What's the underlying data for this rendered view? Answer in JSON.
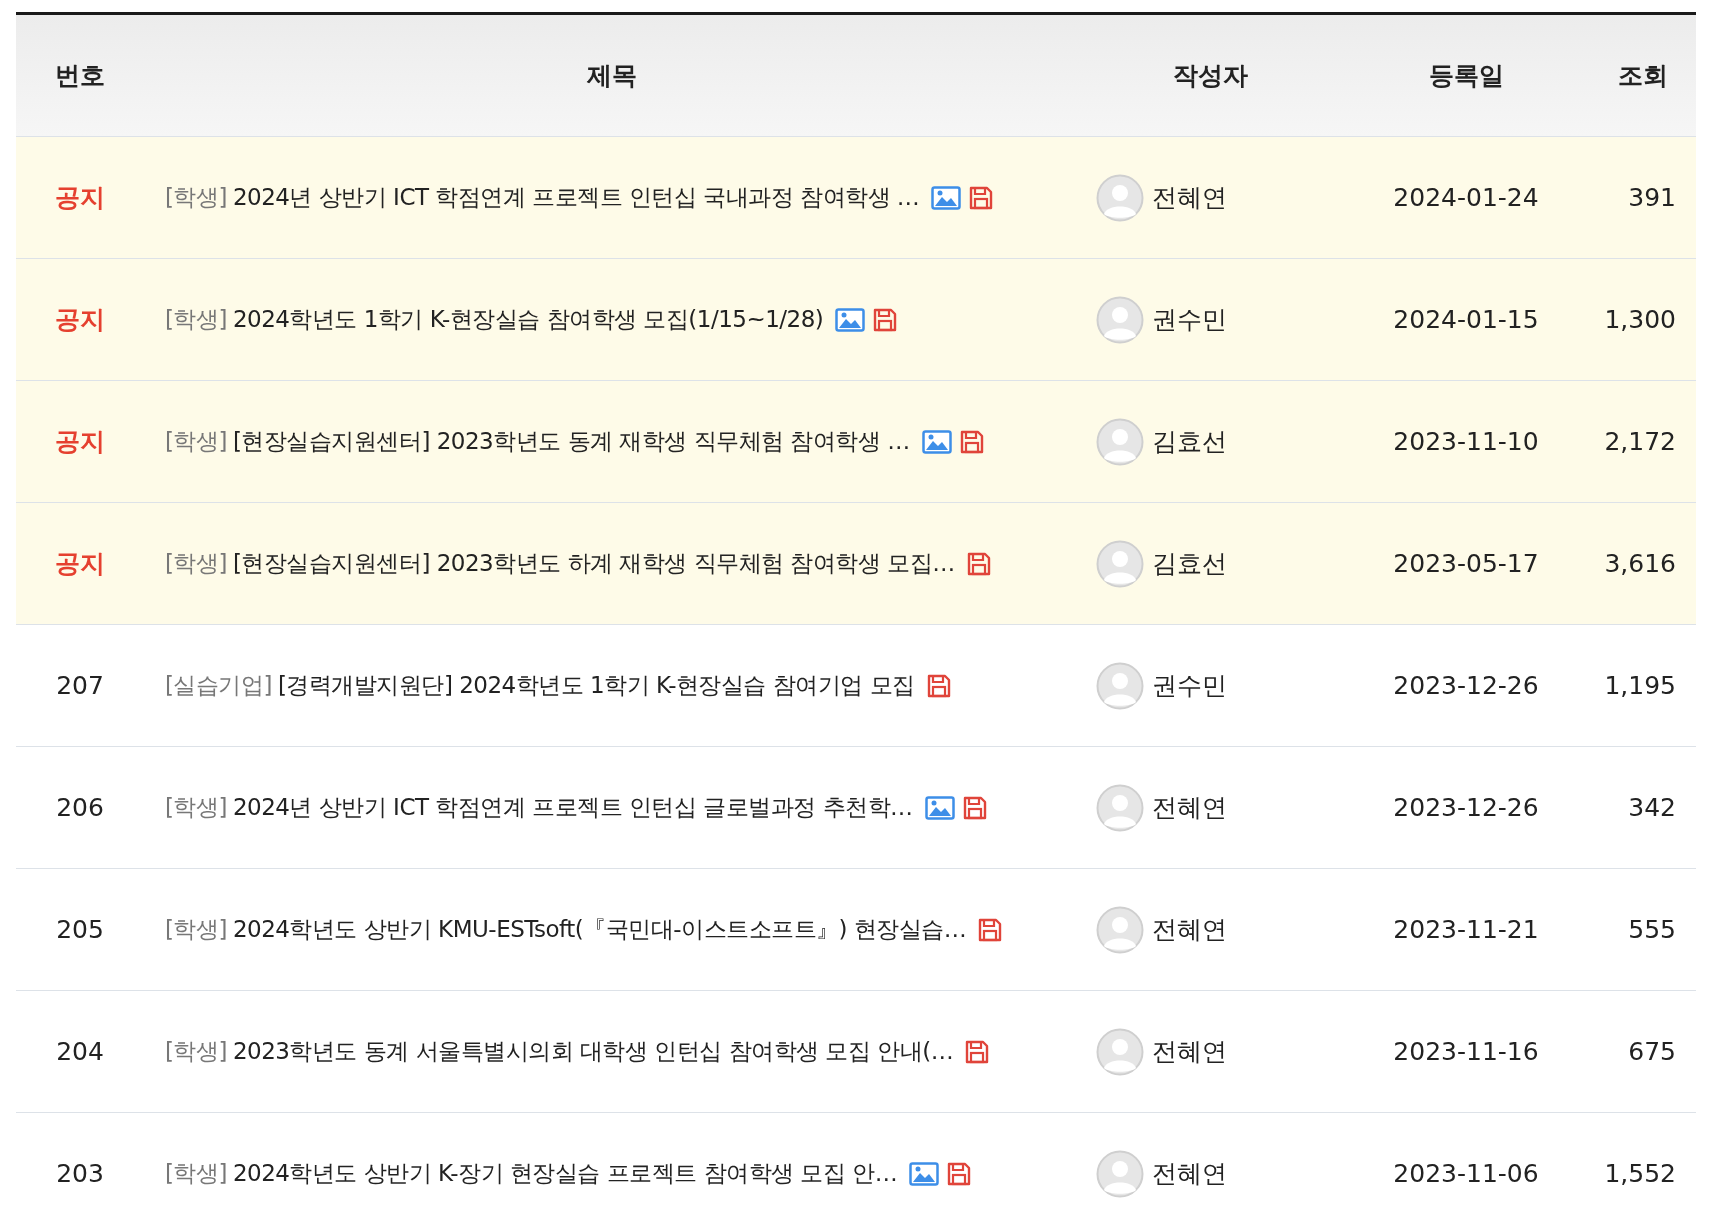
{
  "table": {
    "columns": [
      {
        "label": "번호",
        "kind": "number"
      },
      {
        "label": "제목",
        "kind": "title"
      },
      {
        "label": "작성자",
        "kind": "author"
      },
      {
        "label": "등록일",
        "kind": "date"
      },
      {
        "label": "조회",
        "kind": "views"
      }
    ],
    "rows": [
      {
        "number": "공지",
        "pinned": true,
        "category": "[학생]",
        "title": "2024년 상반기 ICT 학점연계 프로젝트 인턴십 국내과정 참여학생 …",
        "has_image": true,
        "has_file": true,
        "author": "전혜연",
        "date": "2024-01-24",
        "views": "391"
      },
      {
        "number": "공지",
        "pinned": true,
        "category": "[학생]",
        "title": "2024학년도 1학기 K-현장실습 참여학생 모집(1/15~1/28)",
        "has_image": true,
        "has_file": true,
        "author": "권수민",
        "date": "2024-01-15",
        "views": "1,300"
      },
      {
        "number": "공지",
        "pinned": true,
        "category": "[학생]",
        "title": "[현장실습지원센터] 2023학년도 동계 재학생 직무체험 참여학생 …",
        "has_image": true,
        "has_file": true,
        "author": "김효선",
        "date": "2023-11-10",
        "views": "2,172"
      },
      {
        "number": "공지",
        "pinned": true,
        "category": "[학생]",
        "title": "[현장실습지원센터] 2023학년도 하계 재학생 직무체험 참여학생 모집…",
        "has_image": false,
        "has_file": true,
        "author": "김효선",
        "date": "2023-05-17",
        "views": "3,616"
      },
      {
        "number": "207",
        "pinned": false,
        "category": "[실습기업]",
        "title": "[경력개발지원단] 2024학년도 1학기 K-현장실습 참여기업 모집",
        "has_image": false,
        "has_file": true,
        "author": "권수민",
        "date": "2023-12-26",
        "views": "1,195"
      },
      {
        "number": "206",
        "pinned": false,
        "category": "[학생]",
        "title": "2024년 상반기 ICT 학점연계 프로젝트 인턴십 글로벌과정 추천학…",
        "has_image": true,
        "has_file": true,
        "author": "전혜연",
        "date": "2023-12-26",
        "views": "342"
      },
      {
        "number": "205",
        "pinned": false,
        "category": "[학생]",
        "title": "2024학년도 상반기 KMU-ESTsoft(『국민대-이스트소프트』) 현장실습…",
        "has_image": false,
        "has_file": true,
        "author": "전혜연",
        "date": "2023-11-21",
        "views": "555"
      },
      {
        "number": "204",
        "pinned": false,
        "category": "[학생]",
        "title": "2023학년도 동계 서울특별시의회 대학생 인턴십 참여학생 모집 안내(…",
        "has_image": false,
        "has_file": true,
        "author": "전혜연",
        "date": "2023-11-16",
        "views": "675"
      },
      {
        "number": "203",
        "pinned": false,
        "category": "[학생]",
        "title": "2024학년도 상반기 K-장기 현장실습 프로젝트 참여학생 모집 안…",
        "has_image": true,
        "has_file": true,
        "author": "전혜연",
        "date": "2023-11-06",
        "views": "1,552"
      }
    ]
  }
}
